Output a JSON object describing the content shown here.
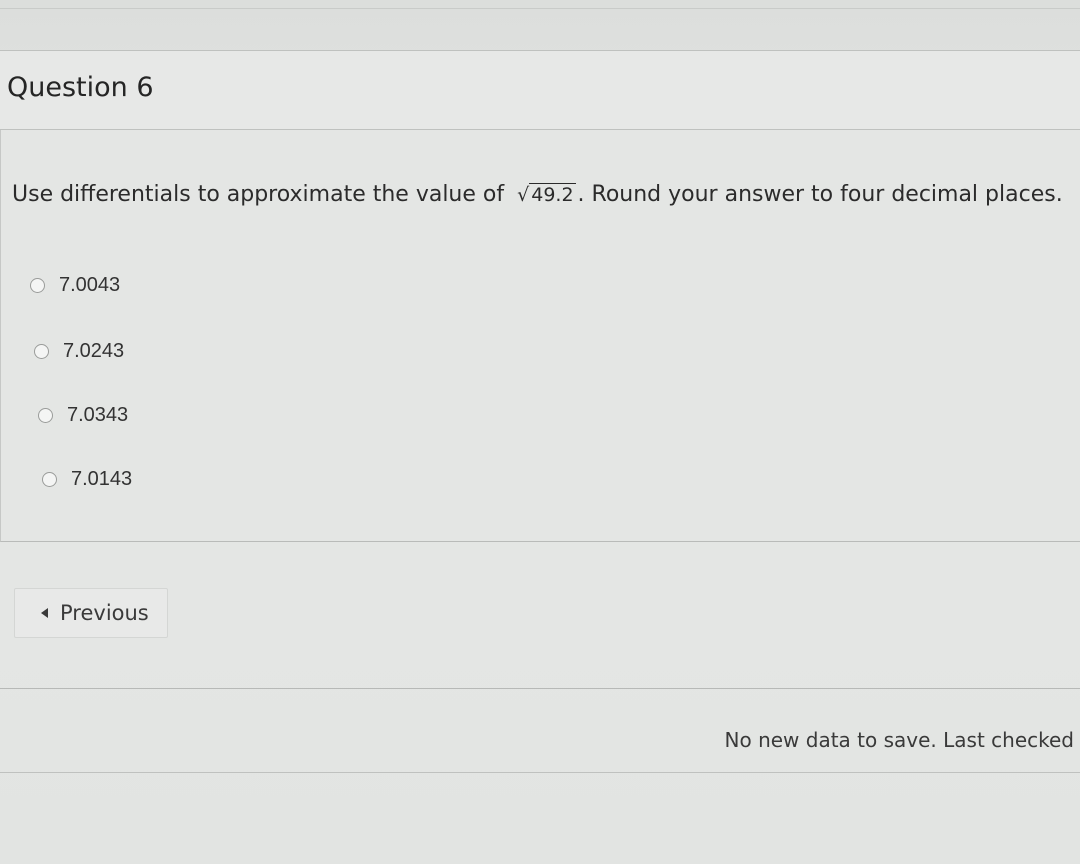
{
  "question": {
    "title": "Question 6",
    "prompt_before": "Use differentials to approximate the value of",
    "radicand": "49.2",
    "prompt_after": ". Round your answer to four decimal places."
  },
  "options": [
    {
      "label": "7.0043",
      "selected": false
    },
    {
      "label": "7.0243",
      "selected": false
    },
    {
      "label": "7.0343",
      "selected": false
    },
    {
      "label": "7.0143",
      "selected": false
    }
  ],
  "navigation": {
    "previous_label": "Previous"
  },
  "status": {
    "save_message": "No new data to save. Last checked"
  }
}
